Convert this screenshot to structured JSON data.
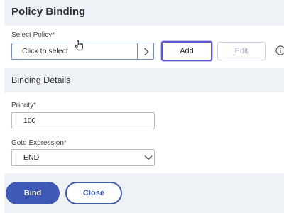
{
  "header": {
    "title": "Policy Binding"
  },
  "select_policy": {
    "label": "Select Policy*",
    "value": "Click to select",
    "add_label": "Add",
    "edit_label": "Edit"
  },
  "binding_details": {
    "title": "Binding Details",
    "priority": {
      "label": "Priority*",
      "value": "100"
    },
    "goto_expression": {
      "label": "Goto Expression*",
      "value": "END"
    }
  },
  "footer": {
    "bind_label": "Bind",
    "close_label": "Close"
  },
  "icons": {
    "arrow": "chevron-right-icon",
    "info": "info-icon",
    "dropdown": "chevron-down-icon",
    "cursor": "hand-cursor-icon"
  },
  "colors": {
    "primary": "#3f59b8",
    "add_focus": "#5a57d6",
    "header_bg": "#eef1f5"
  }
}
